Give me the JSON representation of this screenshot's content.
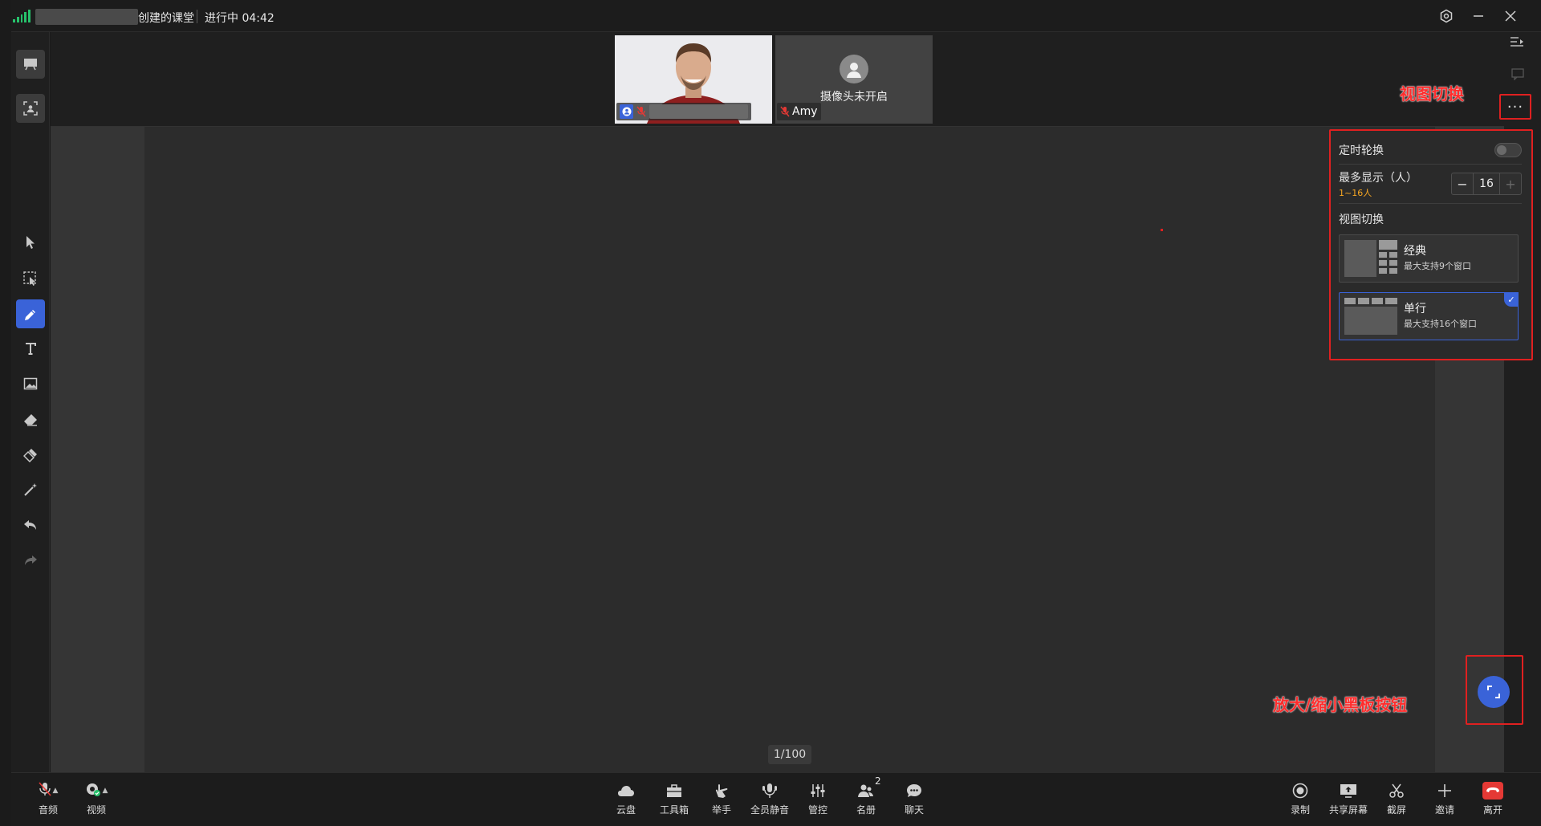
{
  "titlebar": {
    "title": "创建的课堂",
    "status": "进行中 04:42"
  },
  "video": {
    "tiles": [
      {
        "name": "",
        "muted": true
      },
      {
        "name": "Amy",
        "muted": true,
        "camera_off_text": "摄像头未开启"
      }
    ]
  },
  "annotations": {
    "view_switch": "视图切换",
    "zoom_board": "放大/缩小黑板按钮"
  },
  "panel": {
    "timed_rotation_label": "定时轮换",
    "timed_rotation_on": false,
    "max_display_label": "最多显示（人）",
    "max_display_hint": "1~16人",
    "max_display_value": "16",
    "view_switch_label": "视图切换",
    "views": [
      {
        "title": "经典",
        "subtitle": "最大支持9个窗口",
        "selected": false
      },
      {
        "title": "单行",
        "subtitle": "最大支持16个窗口",
        "selected": true
      }
    ]
  },
  "board": {
    "page_indicator": "1/100"
  },
  "bottombar": {
    "left": [
      {
        "label": "音频",
        "icon": "mic-muted-icon"
      },
      {
        "label": "视频",
        "icon": "camera-icon"
      }
    ],
    "center": [
      {
        "label": "云盘",
        "icon": "cloud-icon"
      },
      {
        "label": "工具箱",
        "icon": "toolbox-icon"
      },
      {
        "label": "举手",
        "icon": "raise-hand-icon"
      },
      {
        "label": "全员静音",
        "icon": "mute-all-icon"
      },
      {
        "label": "管控",
        "icon": "controls-icon"
      },
      {
        "label": "名册",
        "icon": "roster-icon",
        "badge": "2"
      },
      {
        "label": "聊天",
        "icon": "chat-icon"
      }
    ],
    "right": [
      {
        "label": "录制",
        "icon": "record-icon"
      },
      {
        "label": "共享屏幕",
        "icon": "share-screen-icon"
      },
      {
        "label": "截屏",
        "icon": "screenshot-icon"
      },
      {
        "label": "邀请",
        "icon": "invite-icon"
      },
      {
        "label": "离开",
        "icon": "leave-icon"
      }
    ]
  },
  "colors": {
    "accent": "#3a63d8",
    "annotation_red": "#e02020",
    "signal_green": "#27c26c",
    "leave_red": "#e53935",
    "hint_orange": "#f5a623"
  }
}
